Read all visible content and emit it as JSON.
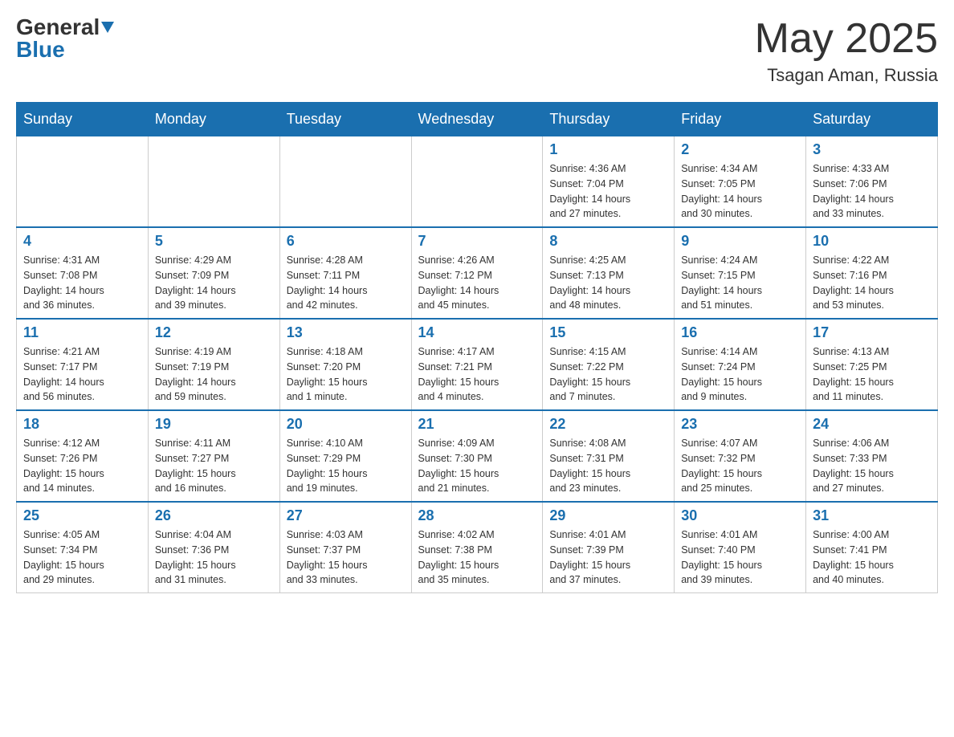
{
  "header": {
    "logo_general": "General",
    "logo_blue": "Blue",
    "month_title": "May 2025",
    "location": "Tsagan Aman, Russia"
  },
  "days_of_week": [
    "Sunday",
    "Monday",
    "Tuesday",
    "Wednesday",
    "Thursday",
    "Friday",
    "Saturday"
  ],
  "weeks": [
    [
      {
        "day": "",
        "info": ""
      },
      {
        "day": "",
        "info": ""
      },
      {
        "day": "",
        "info": ""
      },
      {
        "day": "",
        "info": ""
      },
      {
        "day": "1",
        "info": "Sunrise: 4:36 AM\nSunset: 7:04 PM\nDaylight: 14 hours\nand 27 minutes."
      },
      {
        "day": "2",
        "info": "Sunrise: 4:34 AM\nSunset: 7:05 PM\nDaylight: 14 hours\nand 30 minutes."
      },
      {
        "day": "3",
        "info": "Sunrise: 4:33 AM\nSunset: 7:06 PM\nDaylight: 14 hours\nand 33 minutes."
      }
    ],
    [
      {
        "day": "4",
        "info": "Sunrise: 4:31 AM\nSunset: 7:08 PM\nDaylight: 14 hours\nand 36 minutes."
      },
      {
        "day": "5",
        "info": "Sunrise: 4:29 AM\nSunset: 7:09 PM\nDaylight: 14 hours\nand 39 minutes."
      },
      {
        "day": "6",
        "info": "Sunrise: 4:28 AM\nSunset: 7:11 PM\nDaylight: 14 hours\nand 42 minutes."
      },
      {
        "day": "7",
        "info": "Sunrise: 4:26 AM\nSunset: 7:12 PM\nDaylight: 14 hours\nand 45 minutes."
      },
      {
        "day": "8",
        "info": "Sunrise: 4:25 AM\nSunset: 7:13 PM\nDaylight: 14 hours\nand 48 minutes."
      },
      {
        "day": "9",
        "info": "Sunrise: 4:24 AM\nSunset: 7:15 PM\nDaylight: 14 hours\nand 51 minutes."
      },
      {
        "day": "10",
        "info": "Sunrise: 4:22 AM\nSunset: 7:16 PM\nDaylight: 14 hours\nand 53 minutes."
      }
    ],
    [
      {
        "day": "11",
        "info": "Sunrise: 4:21 AM\nSunset: 7:17 PM\nDaylight: 14 hours\nand 56 minutes."
      },
      {
        "day": "12",
        "info": "Sunrise: 4:19 AM\nSunset: 7:19 PM\nDaylight: 14 hours\nand 59 minutes."
      },
      {
        "day": "13",
        "info": "Sunrise: 4:18 AM\nSunset: 7:20 PM\nDaylight: 15 hours\nand 1 minute."
      },
      {
        "day": "14",
        "info": "Sunrise: 4:17 AM\nSunset: 7:21 PM\nDaylight: 15 hours\nand 4 minutes."
      },
      {
        "day": "15",
        "info": "Sunrise: 4:15 AM\nSunset: 7:22 PM\nDaylight: 15 hours\nand 7 minutes."
      },
      {
        "day": "16",
        "info": "Sunrise: 4:14 AM\nSunset: 7:24 PM\nDaylight: 15 hours\nand 9 minutes."
      },
      {
        "day": "17",
        "info": "Sunrise: 4:13 AM\nSunset: 7:25 PM\nDaylight: 15 hours\nand 11 minutes."
      }
    ],
    [
      {
        "day": "18",
        "info": "Sunrise: 4:12 AM\nSunset: 7:26 PM\nDaylight: 15 hours\nand 14 minutes."
      },
      {
        "day": "19",
        "info": "Sunrise: 4:11 AM\nSunset: 7:27 PM\nDaylight: 15 hours\nand 16 minutes."
      },
      {
        "day": "20",
        "info": "Sunrise: 4:10 AM\nSunset: 7:29 PM\nDaylight: 15 hours\nand 19 minutes."
      },
      {
        "day": "21",
        "info": "Sunrise: 4:09 AM\nSunset: 7:30 PM\nDaylight: 15 hours\nand 21 minutes."
      },
      {
        "day": "22",
        "info": "Sunrise: 4:08 AM\nSunset: 7:31 PM\nDaylight: 15 hours\nand 23 minutes."
      },
      {
        "day": "23",
        "info": "Sunrise: 4:07 AM\nSunset: 7:32 PM\nDaylight: 15 hours\nand 25 minutes."
      },
      {
        "day": "24",
        "info": "Sunrise: 4:06 AM\nSunset: 7:33 PM\nDaylight: 15 hours\nand 27 minutes."
      }
    ],
    [
      {
        "day": "25",
        "info": "Sunrise: 4:05 AM\nSunset: 7:34 PM\nDaylight: 15 hours\nand 29 minutes."
      },
      {
        "day": "26",
        "info": "Sunrise: 4:04 AM\nSunset: 7:36 PM\nDaylight: 15 hours\nand 31 minutes."
      },
      {
        "day": "27",
        "info": "Sunrise: 4:03 AM\nSunset: 7:37 PM\nDaylight: 15 hours\nand 33 minutes."
      },
      {
        "day": "28",
        "info": "Sunrise: 4:02 AM\nSunset: 7:38 PM\nDaylight: 15 hours\nand 35 minutes."
      },
      {
        "day": "29",
        "info": "Sunrise: 4:01 AM\nSunset: 7:39 PM\nDaylight: 15 hours\nand 37 minutes."
      },
      {
        "day": "30",
        "info": "Sunrise: 4:01 AM\nSunset: 7:40 PM\nDaylight: 15 hours\nand 39 minutes."
      },
      {
        "day": "31",
        "info": "Sunrise: 4:00 AM\nSunset: 7:41 PM\nDaylight: 15 hours\nand 40 minutes."
      }
    ]
  ]
}
